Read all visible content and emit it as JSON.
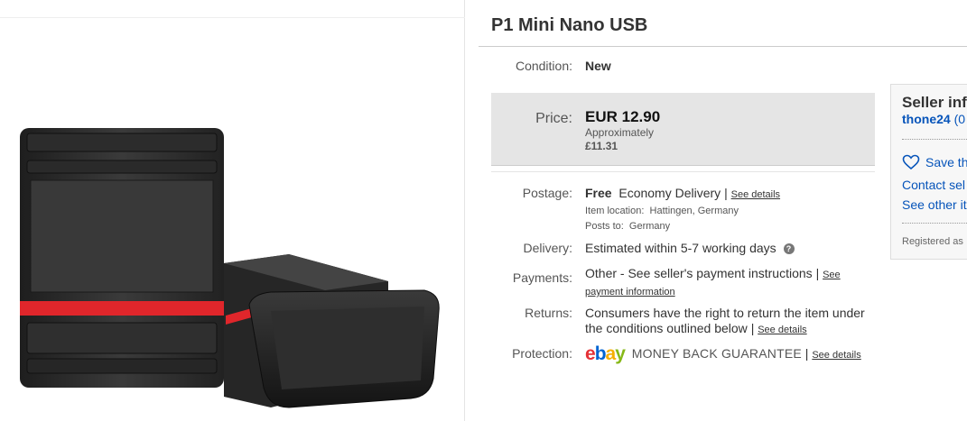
{
  "listing": {
    "title": "P1 Mini Nano USB",
    "condition": {
      "label": "Condition:",
      "value": "New"
    },
    "price": {
      "label": "Price:",
      "amount": "EUR 12.90",
      "approx_label": "Approximately",
      "converted": "£11.31"
    },
    "postage": {
      "label": "Postage:",
      "cost": "Free",
      "service": "Economy Delivery",
      "separator": "|",
      "details_link": "See details",
      "item_location": "Item location:",
      "item_location_value": "Hattingen, Germany",
      "posts_to": "Posts to:",
      "posts_to_value": "Germany"
    },
    "delivery": {
      "label": "Delivery:",
      "value": "Estimated within 5-7 working days",
      "help_glyph": "?"
    },
    "payments": {
      "label": "Payments:",
      "value": "Other - See seller's payment instructions",
      "separator": "|",
      "link": "See payment information"
    },
    "returns": {
      "label": "Returns:",
      "value": "Consumers have the right to return the item under the conditions outlined below",
      "separator": "|",
      "link": "See details"
    },
    "protection": {
      "label": "Protection:",
      "logo_letters": [
        "e",
        "b",
        "a",
        "y"
      ],
      "guarantee": "MONEY BACK GUARANTEE",
      "separator": "|",
      "link": "See details"
    }
  },
  "seller": {
    "title": "Seller inf",
    "name": "thone24",
    "name_suffix": "(0",
    "save": "Save th",
    "contact": "Contact sel",
    "other": "See other it",
    "registered": "Registered as"
  },
  "icons": {
    "help": "help-icon",
    "heart": "heart-icon",
    "ebay_logo": "ebay-logo"
  },
  "colors": {
    "link_blue": "#0654ba",
    "price_box": "#e5e5e5",
    "ebay_e": "#e53238",
    "ebay_b": "#0064d2",
    "ebay_a": "#f5af02",
    "ebay_y": "#86b817",
    "usb_stripe": "#e0262b"
  }
}
